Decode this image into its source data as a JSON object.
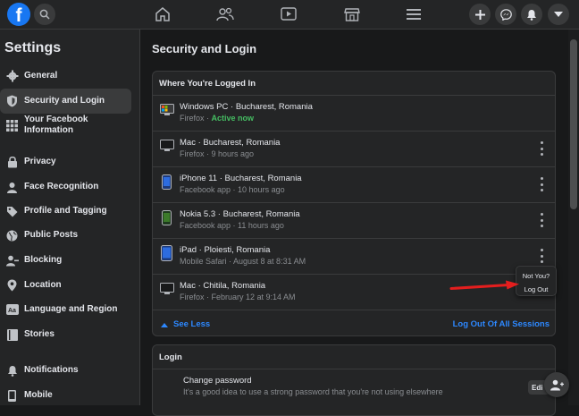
{
  "topbar": {
    "logo": "f",
    "icons": [
      "facebook-logo",
      "search-icon",
      "home-icon",
      "friends-icon",
      "watch-icon",
      "marketplace-icon",
      "menu-icon",
      "plus-icon",
      "messenger-icon",
      "bell-icon",
      "caret-down-icon"
    ]
  },
  "sidebar": {
    "title": "Settings",
    "items": [
      {
        "label": "General",
        "icon": "gear-icon"
      },
      {
        "label": "Security and Login",
        "icon": "shield-icon",
        "active": true
      },
      {
        "label": "Your Facebook Information",
        "icon": "grid-icon"
      },
      {
        "label": "Privacy",
        "icon": "lock-icon"
      },
      {
        "label": "Face Recognition",
        "icon": "face-icon"
      },
      {
        "label": "Profile and Tagging",
        "icon": "tag-icon"
      },
      {
        "label": "Public Posts",
        "icon": "globe-icon"
      },
      {
        "label": "Blocking",
        "icon": "block-user-icon"
      },
      {
        "label": "Location",
        "icon": "pin-icon"
      },
      {
        "label": "Language and Region",
        "icon": "language-icon"
      },
      {
        "label": "Stories",
        "icon": "book-icon"
      },
      {
        "label": "Notifications",
        "icon": "bell-icon"
      },
      {
        "label": "Mobile",
        "icon": "phone-icon"
      }
    ]
  },
  "main": {
    "title": "Security and Login",
    "sessions_card": {
      "title": "Where You're Logged In",
      "sessions": [
        {
          "device": "Windows PC · Bucharest, Romania",
          "app": "Firefox · ",
          "status": "Active now",
          "icon": "desktop-icon"
        },
        {
          "device": "Mac · Bucharest, Romania",
          "app": "Firefox · 9 hours ago",
          "icon": "desktop-icon"
        },
        {
          "device": "iPhone 11 · Bucharest, Romania",
          "app": "Facebook app · 10 hours ago",
          "icon": "mobile-icon"
        },
        {
          "device": "Nokia 5.3 · Bucharest, Romania",
          "app": "Facebook app · 11 hours ago",
          "icon": "mobile-icon"
        },
        {
          "device": "iPad · Ploiesti, Romania",
          "app": "Mobile Safari · August 8 at 8:31 AM",
          "icon": "tablet-icon"
        },
        {
          "device": "Mac · Chitila, Romania",
          "app": "Firefox · February 12 at 9:14 AM",
          "icon": "desktop-icon"
        }
      ],
      "see_less": "See Less",
      "log_out_all": "Log Out Of All Sessions"
    },
    "popup": {
      "not_you": "Not You?",
      "log_out": "Log Out"
    },
    "login_card": {
      "title": "Login",
      "change_password_title": "Change password",
      "change_password_desc": "It's a good idea to use a strong password that you're not using elsewhere",
      "edit": "Edi"
    }
  },
  "colors": {
    "accent": "#2d88ff",
    "active_green": "#45bd62",
    "annotation_red": "#e41e1e"
  }
}
